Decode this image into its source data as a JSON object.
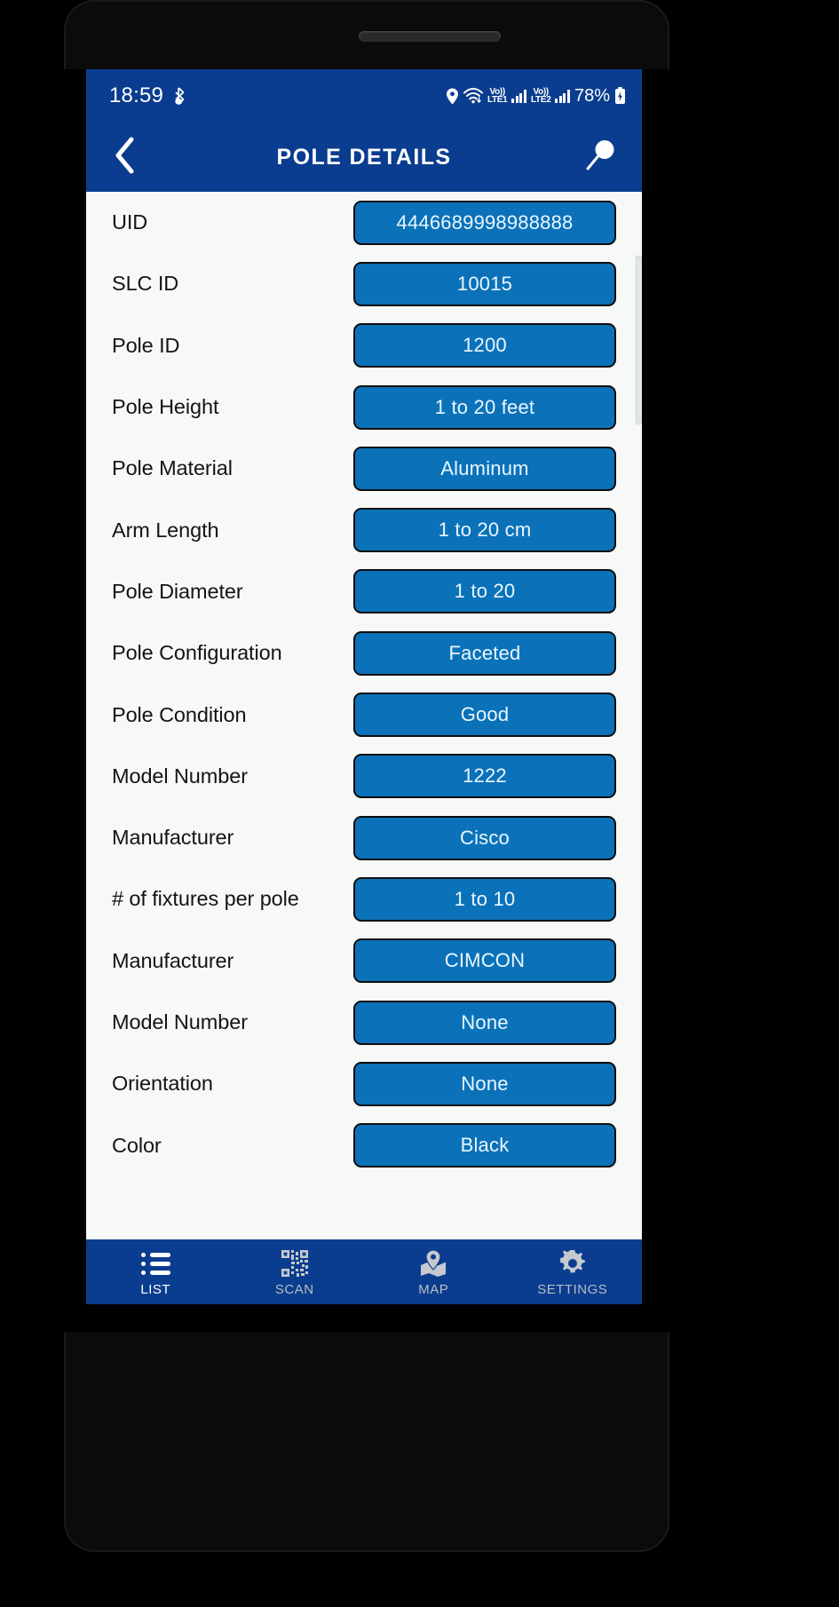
{
  "status_bar": {
    "clock": "18:59",
    "battery_percent": "78%",
    "network_1": {
      "volte": "Vo))",
      "tech": "LTE1"
    },
    "network_2": {
      "volte": "Vo))",
      "tech": "LTE2"
    },
    "icons": [
      "bluetooth-audio-icon",
      "location-icon",
      "wifi-icon",
      "signal-bars-icon",
      "battery-icon"
    ]
  },
  "header": {
    "title": "POLE DETAILS",
    "back_icon": "chevron-left-icon",
    "search_icon": "search-icon"
  },
  "details": {
    "rows": [
      {
        "label": "UID",
        "value": "4446689998988888"
      },
      {
        "label": "SLC ID",
        "value": "10015"
      },
      {
        "label": "Pole ID",
        "value": "1200"
      },
      {
        "label": "Pole Height",
        "value": "1 to 20 feet"
      },
      {
        "label": "Pole Material",
        "value": "Aluminum"
      },
      {
        "label": "Arm Length",
        "value": "1 to 20 cm"
      },
      {
        "label": "Pole Diameter",
        "value": "1 to 20"
      },
      {
        "label": "Pole Configuration",
        "value": "Faceted"
      },
      {
        "label": "Pole Condition",
        "value": "Good"
      },
      {
        "label": "Model Number",
        "value": "1222"
      },
      {
        "label": "Manufacturer",
        "value": "Cisco"
      },
      {
        "label": "# of fixtures per pole",
        "value": "1 to 10"
      },
      {
        "label": "Manufacturer",
        "value": "CIMCON"
      },
      {
        "label": "Model Number",
        "value": "None"
      },
      {
        "label": "Orientation",
        "value": "None"
      },
      {
        "label": "Color",
        "value": "Black"
      }
    ]
  },
  "tab_bar": {
    "tabs": [
      {
        "label": "LIST",
        "icon": "list-icon",
        "active": true
      },
      {
        "label": "SCAN",
        "icon": "qr-code-icon",
        "active": false
      },
      {
        "label": "MAP",
        "icon": "map-pin-icon",
        "active": false
      },
      {
        "label": "SETTINGS",
        "icon": "gear-icon",
        "active": false
      }
    ]
  },
  "android_nav": {
    "recents_icon": "recents-icon",
    "home_icon": "home-icon",
    "back_icon": "back-chevron-icon"
  },
  "colors": {
    "header_blue": "#0a3d8f",
    "value_blue": "#0b72b9",
    "screen_bg": "#f7f8f8",
    "inactive_tab": "#b9bdc2"
  }
}
